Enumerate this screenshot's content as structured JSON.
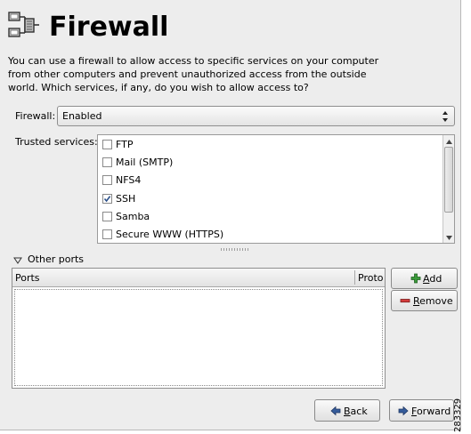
{
  "header": {
    "title": "Firewall",
    "icon": "firewall-network-icon"
  },
  "intro": {
    "text": "You can use a firewall to allow access to specific services on your computer from other computers and prevent unauthorized access from the outside world.  Which services, if any, do you wish to allow access to?"
  },
  "firewall": {
    "label": "Firewall:",
    "value": "Enabled"
  },
  "trusted": {
    "label": "Trusted services:",
    "services": [
      {
        "label": "FTP",
        "checked": false
      },
      {
        "label": "Mail (SMTP)",
        "checked": false
      },
      {
        "label": "NFS4",
        "checked": false
      },
      {
        "label": "SSH",
        "checked": true
      },
      {
        "label": "Samba",
        "checked": false
      },
      {
        "label": "Secure WWW (HTTPS)",
        "checked": false
      }
    ]
  },
  "other_ports": {
    "label": "Other ports",
    "expanded": true,
    "columns": [
      "Ports",
      "Proto"
    ],
    "rows": []
  },
  "buttons": {
    "add_prefix": "",
    "add_mnemonic": "A",
    "add_rest": "dd",
    "remove_prefix": "",
    "remove_mnemonic": "R",
    "remove_rest": "emove",
    "back_prefix": "",
    "back_mnemonic": "B",
    "back_rest": "ack",
    "forward_prefix": "",
    "forward_mnemonic": "F",
    "forward_rest": "orward"
  },
  "figure_number": "283329",
  "colors": {
    "window_bg": "#ededed",
    "add_icon": "#2e8b2e",
    "remove_icon": "#d03030",
    "nav_arrow": "#355c9b"
  }
}
